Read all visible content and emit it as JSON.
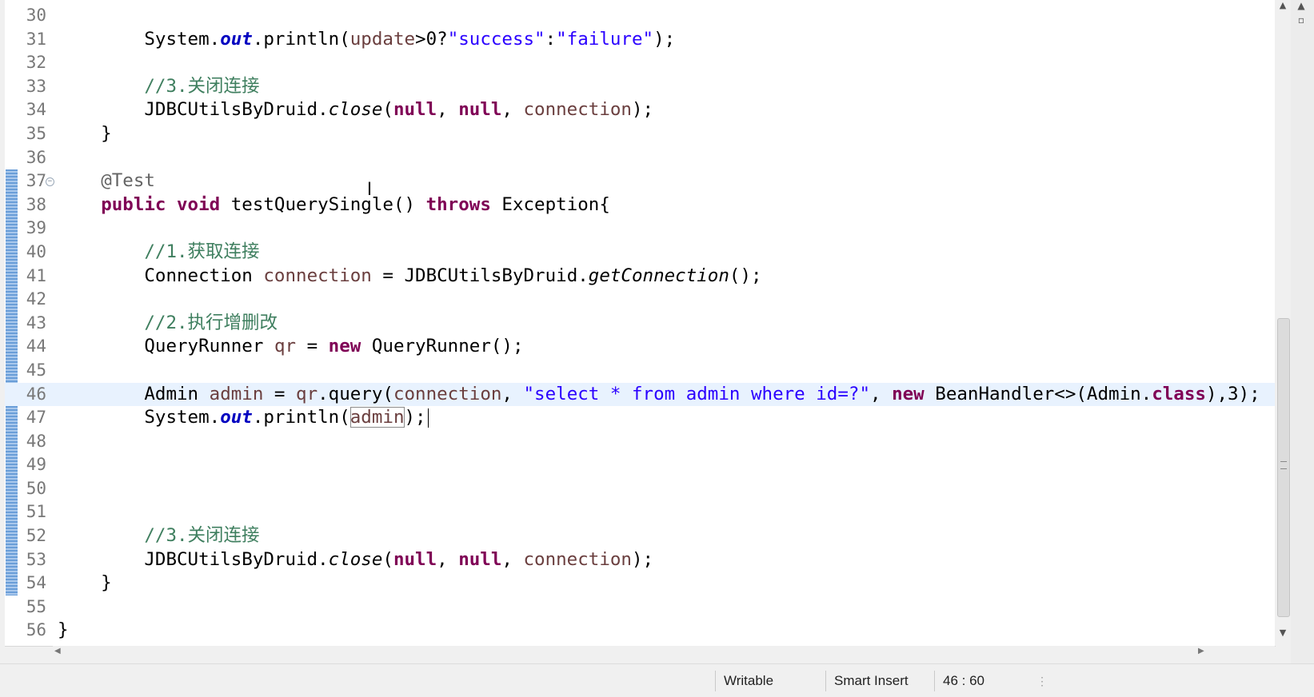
{
  "editor": {
    "lines": [
      {
        "n": "30",
        "html": ""
      },
      {
        "n": "31",
        "html": "        System.<span class=\"fld\">out</span>.println(<span class=\"var\">update</span>&gt;0?<span class=\"str\">\"success\"</span>:<span class=\"str\">\"failure\"</span>);"
      },
      {
        "n": "32",
        "html": ""
      },
      {
        "n": "33",
        "html": "        <span class=\"cm\">//3.关闭连接</span>"
      },
      {
        "n": "34",
        "html": "        JDBCUtilsByDruid.<span class=\"st\">close</span>(<span class=\"kw\">null</span>, <span class=\"kw\">null</span>, <span class=\"var\">connection</span>);"
      },
      {
        "n": "35",
        "html": "    }"
      },
      {
        "n": "36",
        "html": ""
      },
      {
        "n": "37",
        "html": "    <span class=\"ann\">@Test</span>",
        "fold": true
      },
      {
        "n": "38",
        "html": "    <span class=\"kw\">public</span> <span class=\"kw\">void</span> testQuerySingle() <span class=\"kw\">throws</span> Exception{"
      },
      {
        "n": "39",
        "html": ""
      },
      {
        "n": "40",
        "html": "        <span class=\"cm\">//1.获取连接</span>"
      },
      {
        "n": "41",
        "html": "        Connection <span class=\"var\">connection</span> = JDBCUtilsByDruid.<span class=\"st\">getConnection</span>();"
      },
      {
        "n": "42",
        "html": ""
      },
      {
        "n": "43",
        "html": "        <span class=\"cm\">//2.执行增删改</span>"
      },
      {
        "n": "44",
        "html": "        QueryRunner <span class=\"var\">qr</span> = <span class=\"kw\">new</span> QueryRunner();"
      },
      {
        "n": "45",
        "html": ""
      },
      {
        "n": "46",
        "html": "        Admin <span class=\"var\">admin</span> = <span class=\"var\">qr</span>.query(<span class=\"var\">connection</span>, <span class=\"str\">\"select * from admin where id=?\"</span>, <span class=\"kw\">new</span> BeanHandler&lt;&gt;(Admin.<span class=\"kw\">class</span>),3);",
        "current": true
      },
      {
        "n": "47",
        "html": "        System.<span class=\"fld\">out</span>.println(<span class=\"var boxed\">admin</span>);<span class=\"caret\"></span>"
      },
      {
        "n": "48",
        "html": ""
      },
      {
        "n": "49",
        "html": ""
      },
      {
        "n": "50",
        "html": ""
      },
      {
        "n": "51",
        "html": ""
      },
      {
        "n": "52",
        "html": "        <span class=\"cm\">//3.关闭连接</span>"
      },
      {
        "n": "53",
        "html": "        JDBCUtilsByDruid.<span class=\"st\">close</span>(<span class=\"kw\">null</span>, <span class=\"kw\">null</span>, <span class=\"var\">connection</span>);"
      },
      {
        "n": "54",
        "html": "    }"
      },
      {
        "n": "55",
        "html": ""
      },
      {
        "n": "56",
        "html": "}"
      }
    ]
  },
  "status": {
    "mode": "Writable",
    "insert": "Smart Insert",
    "position": "46 : 60"
  },
  "icons": {
    "fold": "collapse-icon",
    "scroll_up": "scroll-up-arrow",
    "scroll_down": "scroll-down-arrow"
  },
  "colors": {
    "keyword": "#7f0055",
    "string": "#2a00ff",
    "comment": "#3f7f5f",
    "field": "#0000c0",
    "current_line": "#e8f2fe"
  }
}
